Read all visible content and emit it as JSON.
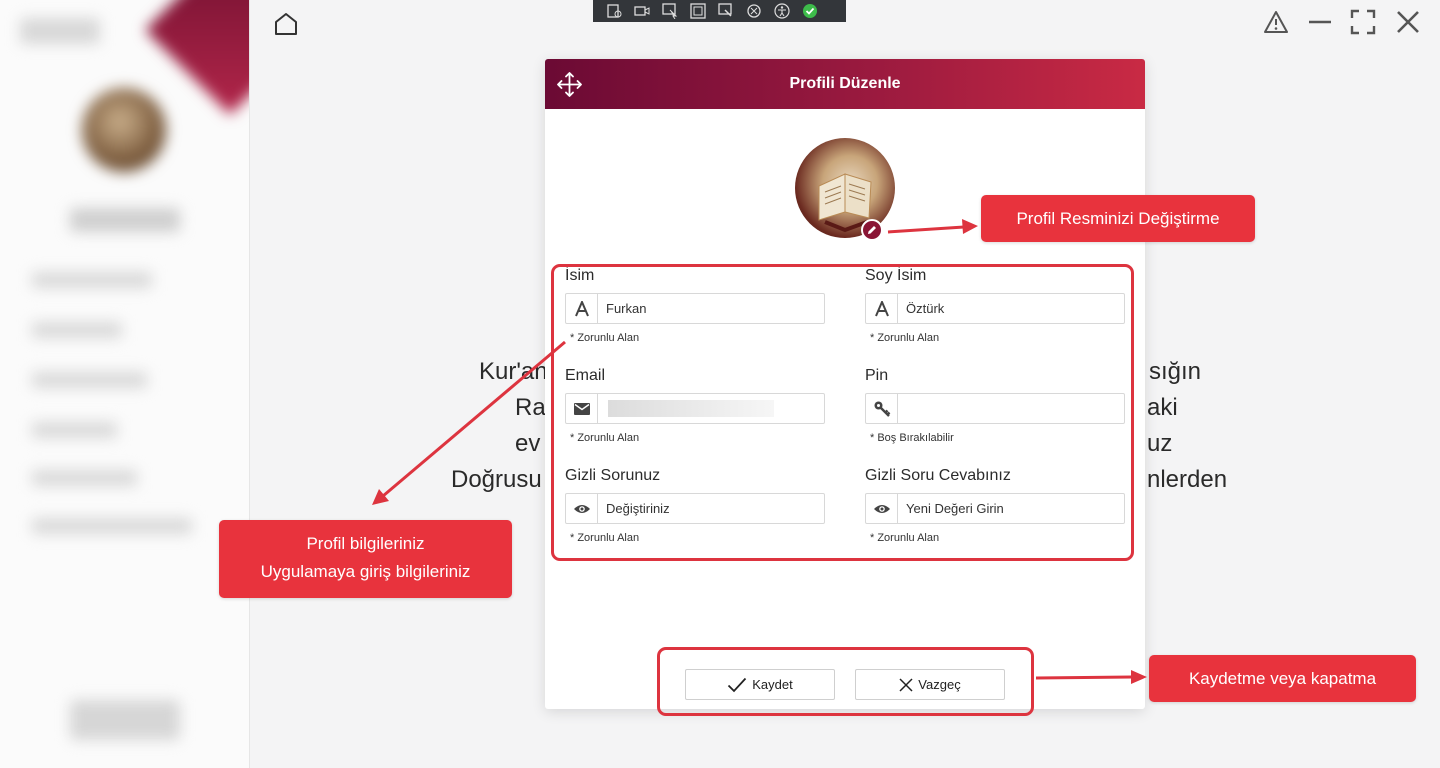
{
  "modal": {
    "title": "Profili Düzenle",
    "fields": {
      "first_name": {
        "label": "İsim",
        "icon": "letter-a-icon",
        "value": "Furkan",
        "hint": "* Zorunlu Alan"
      },
      "last_name": {
        "label": "Soy İsim",
        "icon": "letter-a-icon",
        "value": "Öztürk",
        "hint": "* Zorunlu Alan"
      },
      "email": {
        "label": "Email",
        "icon": "envelope-icon",
        "value": "",
        "hint": "* Zorunlu Alan"
      },
      "pin": {
        "label": "Pin",
        "icon": "key-icon",
        "value": "",
        "hint": "* Boş Bırakılabilir"
      },
      "secret_question": {
        "label": "Gizli Sorunuz",
        "icon": "eye-icon",
        "placeholder": "Değiştiriniz",
        "hint": "* Zorunlu Alan"
      },
      "secret_answer": {
        "label": "Gizli Soru Cevabınız",
        "icon": "eye-icon",
        "placeholder": "Yeni Değeri Girin",
        "hint": "* Zorunlu Alan"
      }
    },
    "buttons": {
      "save": "Kaydet",
      "cancel": "Vazgeç"
    }
  },
  "annotations": {
    "photo": "Profil Resminizi Değiştirme",
    "info_line1": "Profil bilgileriniz",
    "info_line2": "Uygulamaya giriş bilgileriniz",
    "actions": "Kaydetme veya kapatma"
  },
  "background_text": {
    "line1_left": "Kur'an",
    "line1_right": "sığın",
    "line2_left": "Ra",
    "line2_right": "aki",
    "line3_left": "ev",
    "line3_right": "uz",
    "line4_left": "Doğrusu",
    "line4_right": "nlerden"
  },
  "colors": {
    "header_start": "#6b0a34",
    "header_end": "#c92a44",
    "annotation_red": "#e8333d",
    "edit_badge": "#8a1535"
  },
  "icons": {
    "home": "home-icon",
    "warning": "warning-icon",
    "minimize": "minimize-icon",
    "fullscreen": "fullscreen-icon",
    "close": "close-icon",
    "move": "move-icon"
  }
}
